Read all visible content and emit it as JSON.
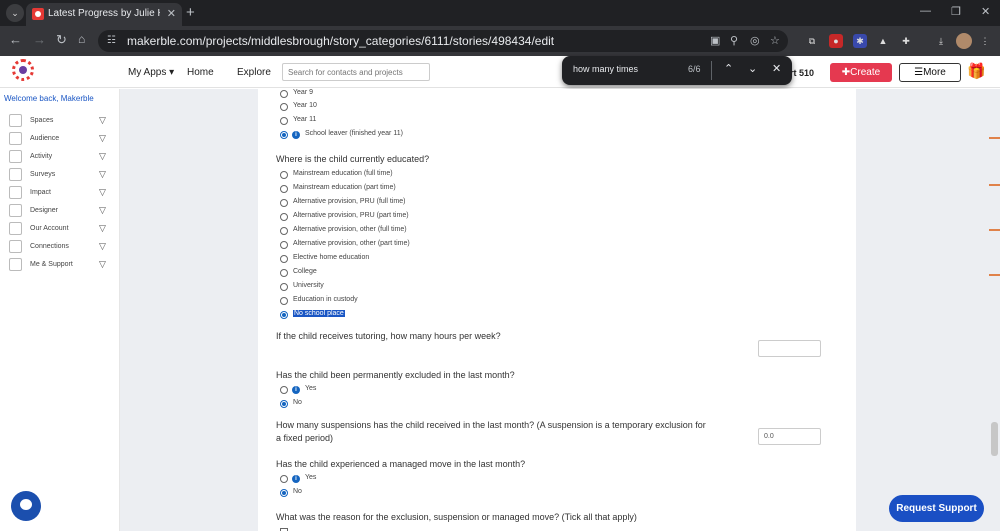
{
  "browser": {
    "tab_title": "Latest Progress by Julie Hunter",
    "url": "makerble.com/projects/middlesbrough/story_categories/6111/stories/498434/edit"
  },
  "header": {
    "nav": [
      "My Apps ▾",
      "Home",
      "Explore"
    ],
    "search_placeholder": "Search for contacts and projects",
    "partial_text": "rt 510",
    "create_label": "✚Create",
    "more_label": "☰More"
  },
  "find_bar": {
    "query": "how many times",
    "count": "6/6"
  },
  "sidebar": {
    "welcome": "Welcome back, Makerble",
    "items": [
      "Spaces",
      "Audience",
      "Activity",
      "Surveys",
      "Impact",
      "Designer",
      "Our Account",
      "Connections",
      "Me & Support"
    ]
  },
  "form": {
    "year_options": [
      {
        "label": "Year 9",
        "checked": false,
        "info": false
      },
      {
        "label": "Year 10",
        "checked": false,
        "info": false
      },
      {
        "label": "Year 11",
        "checked": false,
        "info": false
      },
      {
        "label": "School leaver (finished year 11)",
        "checked": true,
        "info": true
      }
    ],
    "q_educated": "Where is the child currently educated?",
    "educated_options": [
      {
        "label": "Mainstream education (full time)",
        "checked": false
      },
      {
        "label": "Mainstream education (part time)",
        "checked": false
      },
      {
        "label": "Alternative provision, PRU (full time)",
        "checked": false
      },
      {
        "label": "Alternative provision, PRU (part time)",
        "checked": false
      },
      {
        "label": "Alternative provision, other (full time)",
        "checked": false
      },
      {
        "label": "Alternative provision, other (part time)",
        "checked": false
      },
      {
        "label": "Elective home education",
        "checked": false
      },
      {
        "label": "College",
        "checked": false
      },
      {
        "label": "University",
        "checked": false
      },
      {
        "label": "Education in custody",
        "checked": false
      },
      {
        "label": "No school place",
        "checked": true
      }
    ],
    "q_tutoring": "If the child receives tutoring, how many hours per week?",
    "q_excluded": "Has the child been permanently excluded in the last month?",
    "excluded_options": [
      {
        "label": "Yes",
        "checked": false,
        "info": true
      },
      {
        "label": "No",
        "checked": true,
        "info": false
      }
    ],
    "q_suspensions_line1": "How many suspensions has the child received in the last month? (A suspension is a temporary exclusion for",
    "q_suspensions_line2": "a fixed period)",
    "suspensions_value": "0.0",
    "q_managed_move": "Has the child experienced a managed move in the last month?",
    "managed_options": [
      {
        "label": "Yes",
        "checked": false,
        "info": true
      },
      {
        "label": "No",
        "checked": true,
        "info": false
      }
    ],
    "q_reason": "What was the reason for the exclusion, suspension or managed move? (Tick all that apply)"
  },
  "support_label": "Request Support"
}
